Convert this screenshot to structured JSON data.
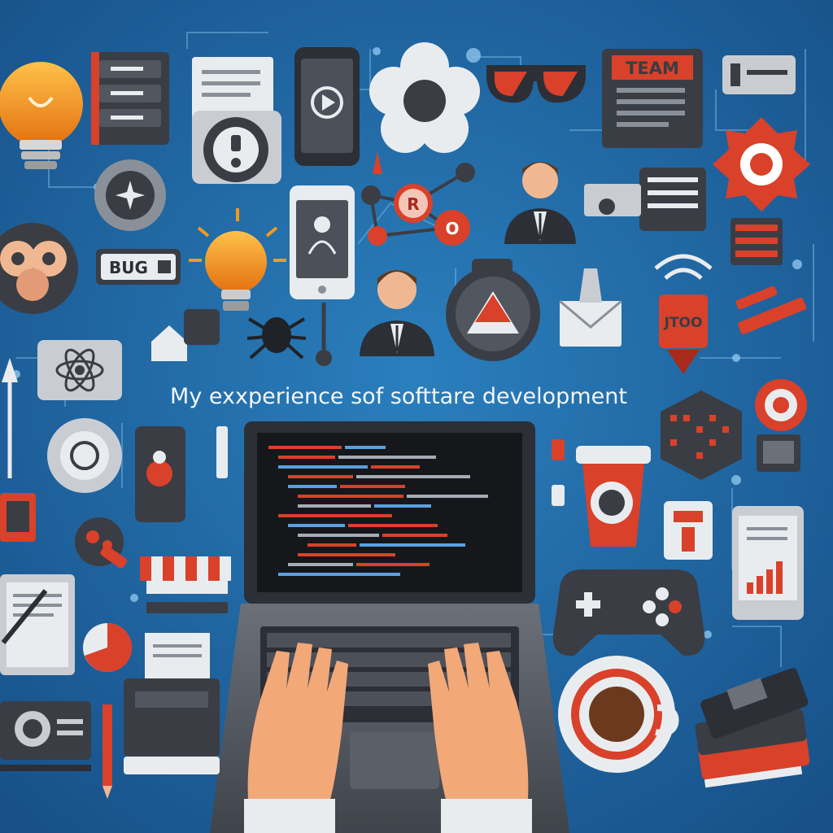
{
  "title": "My exxperience sof softtare development",
  "labels": {
    "bug": "BUG",
    "team": "TEAM",
    "ro_r": "R",
    "ro_o": "O",
    "sign": "JTOO"
  },
  "colors": {
    "background": "#1d5c97",
    "background_light": "#2a79b6",
    "accent": "#d9412a",
    "dark": "#3a3d44",
    "light": "#e9ecef",
    "bulb": "#f39a1d"
  }
}
